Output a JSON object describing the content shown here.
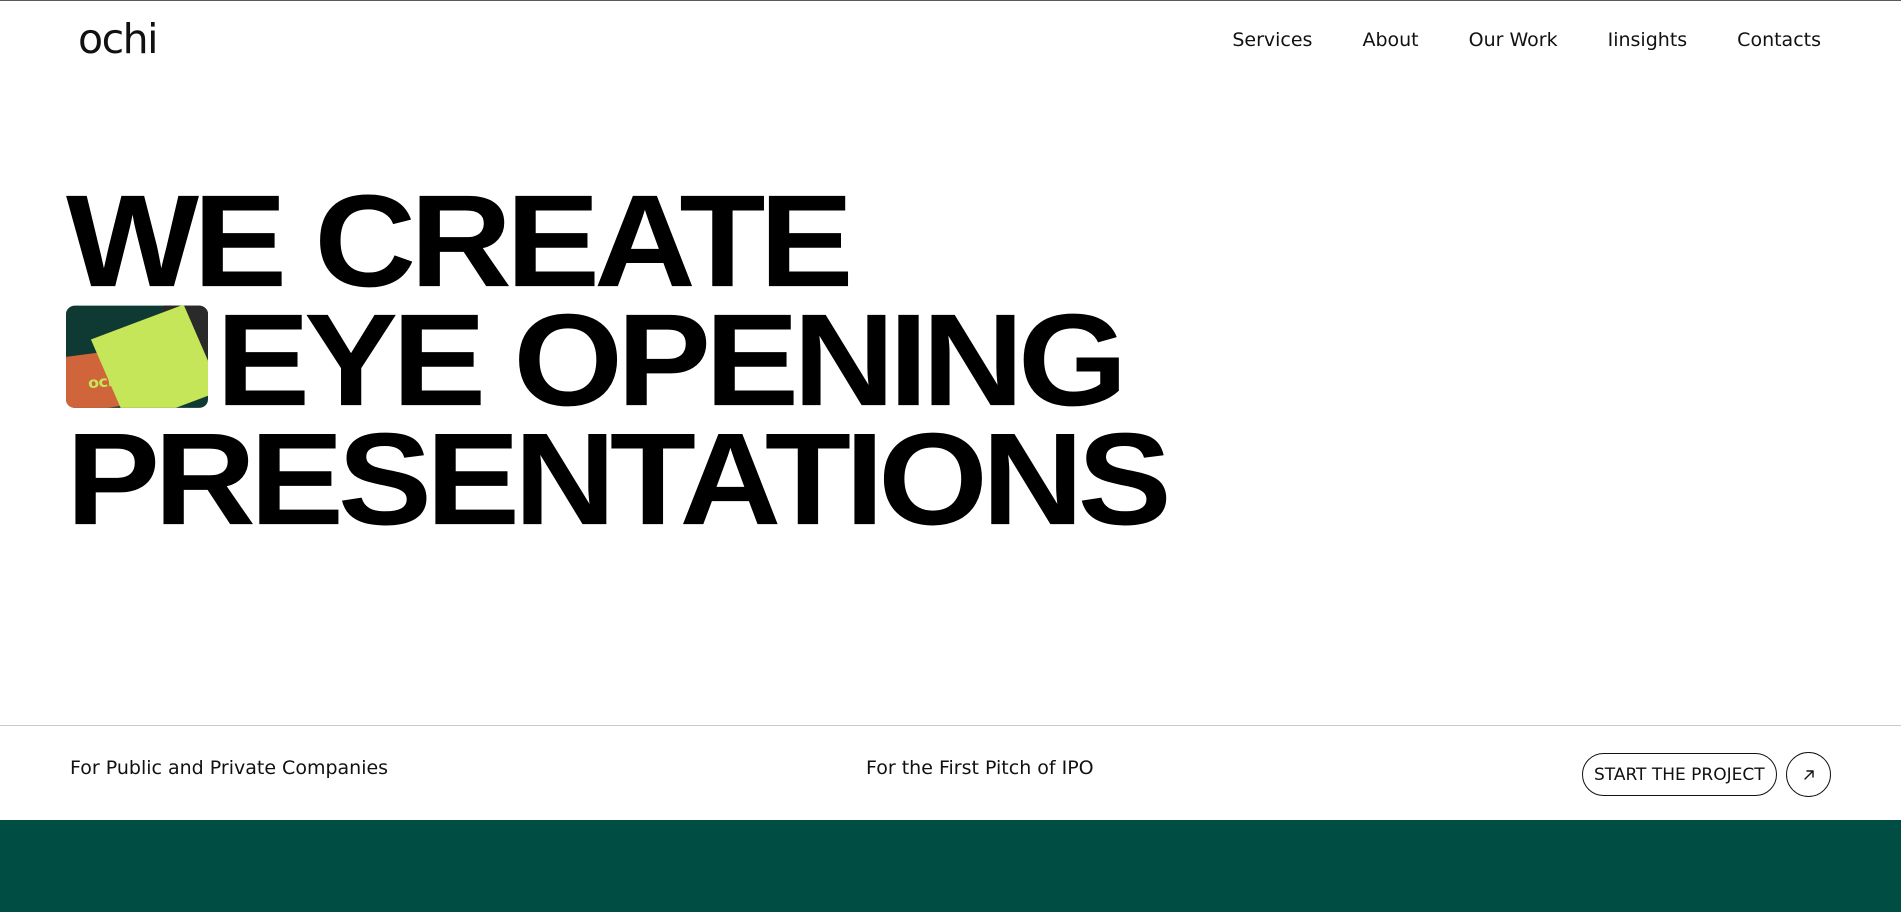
{
  "brand": {
    "logo_text": "ochi",
    "thumb_text": "ochi"
  },
  "nav": {
    "items": [
      {
        "label": "Services"
      },
      {
        "label": "About"
      },
      {
        "label": "Our Work"
      },
      {
        "label": "Iinsights"
      },
      {
        "label": "Contacts"
      }
    ]
  },
  "hero": {
    "line1": "WE CREATE",
    "line2": "EYE OPENING",
    "line3": "PRESENTATIONS"
  },
  "info": {
    "left": "For Public and Private Companies",
    "mid": "For the First Pitch of IPO",
    "cta_label": "START THE PROJECT",
    "cta_icon": "arrow-up-right-icon"
  },
  "colors": {
    "band": "#004d43",
    "thumb_lime": "#c6e65a",
    "thumb_orange": "#d0643a",
    "thumb_dark": "#0f3a33"
  }
}
